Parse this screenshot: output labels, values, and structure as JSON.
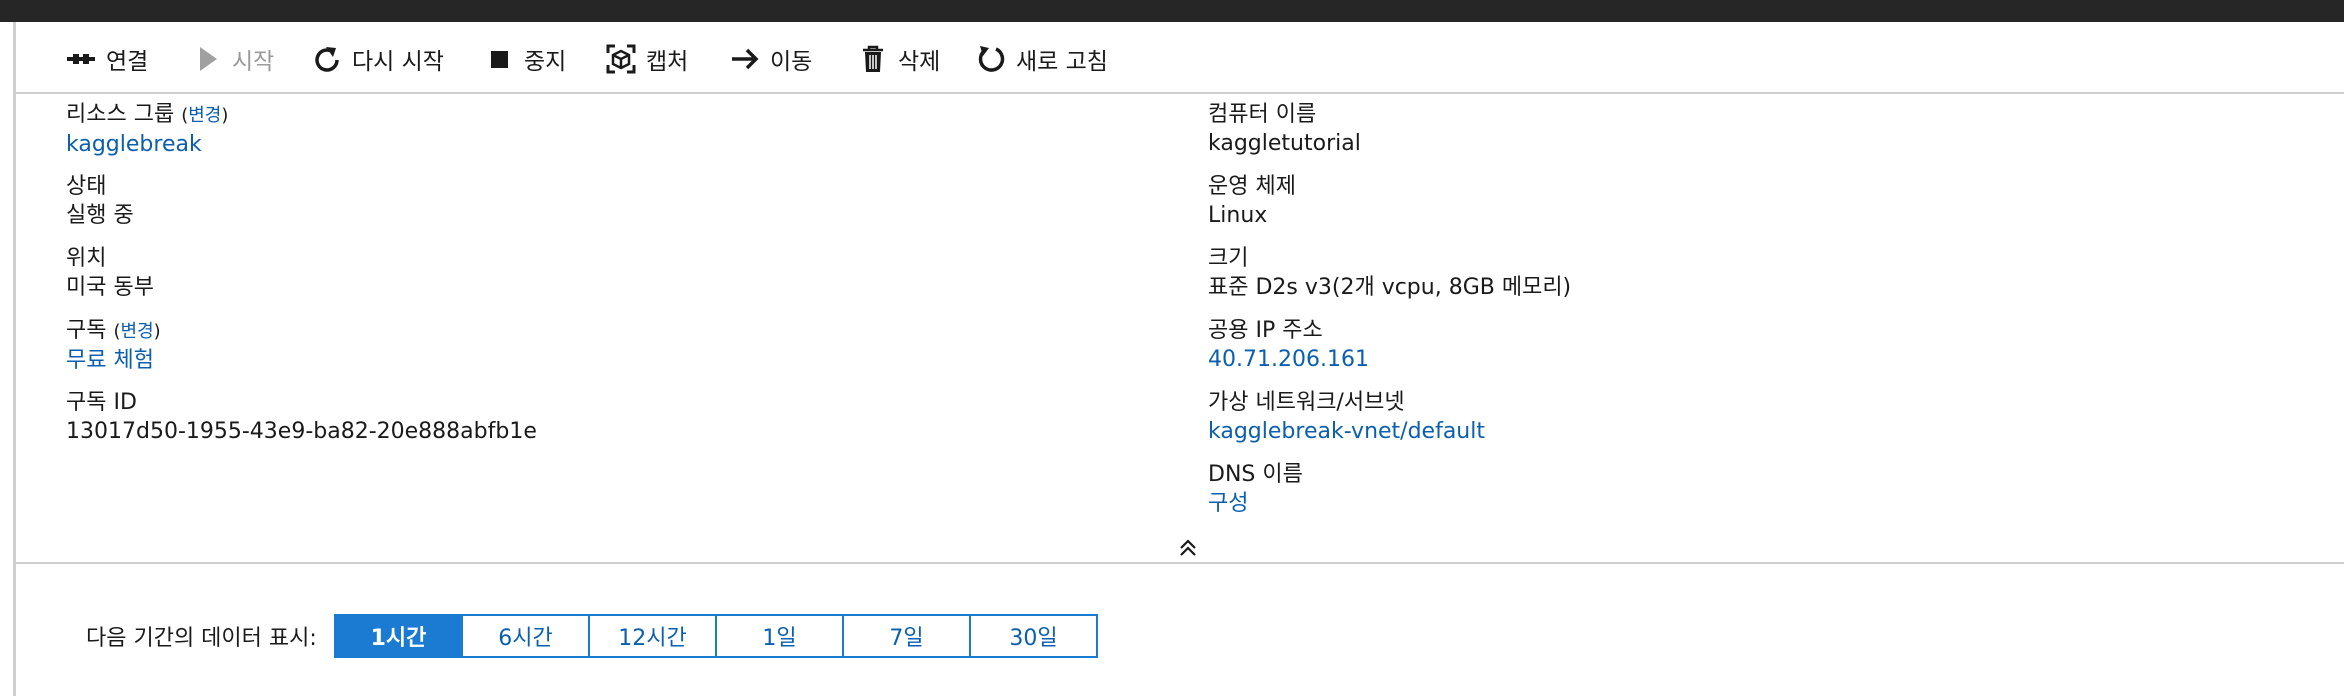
{
  "toolbar": {
    "items": [
      {
        "label": "연결",
        "icon": "plug-icon"
      },
      {
        "label": "시작",
        "icon": "play-icon",
        "disabled": true
      },
      {
        "label": "다시 시작",
        "icon": "restart-icon"
      },
      {
        "label": "중지",
        "icon": "stop-icon"
      },
      {
        "label": "캡처",
        "icon": "capture-icon"
      },
      {
        "label": "이동",
        "icon": "arrow-right-icon"
      },
      {
        "label": "삭제",
        "icon": "trash-icon"
      },
      {
        "label": "새로 고침",
        "icon": "refresh-icon"
      }
    ]
  },
  "essentials": {
    "change_label": "변경",
    "resource_group": {
      "label": "리소스 그룹",
      "value": "kagglebreak"
    },
    "status": {
      "label": "상태",
      "value": "실행 중"
    },
    "location": {
      "label": "위치",
      "value": "미국 동부"
    },
    "subscription": {
      "label": "구독",
      "value": "무료 체험"
    },
    "subscription_id": {
      "label": "구독 ID",
      "value": "13017d50-1955-43e9-ba82-20e888abfb1e"
    },
    "computer_name": {
      "label": "컴퓨터 이름",
      "value": "kaggletutorial"
    },
    "os": {
      "label": "운영 체제",
      "value": "Linux"
    },
    "size": {
      "label": "크기",
      "value": "표준 D2s v3(2개 vcpu, 8GB 메모리)"
    },
    "public_ip": {
      "label": "공용 IP 주소",
      "value": "40.71.206.161"
    },
    "vnet": {
      "label": "가상 네트워크/서브넷",
      "value": "kagglebreak-vnet/default"
    },
    "dns": {
      "label": "DNS 이름",
      "value": "구성"
    }
  },
  "collapse_icon": "chevron-double-up-icon",
  "period": {
    "label": "다음 기간의 데이터 표시:",
    "options": [
      "1시간",
      "6시간",
      "12시간",
      "1일",
      "7일",
      "30일"
    ],
    "selected": "1시간"
  },
  "colors": {
    "accent": "#1b7ad1",
    "link": "#0a5fb0",
    "topbar": "#262626"
  }
}
